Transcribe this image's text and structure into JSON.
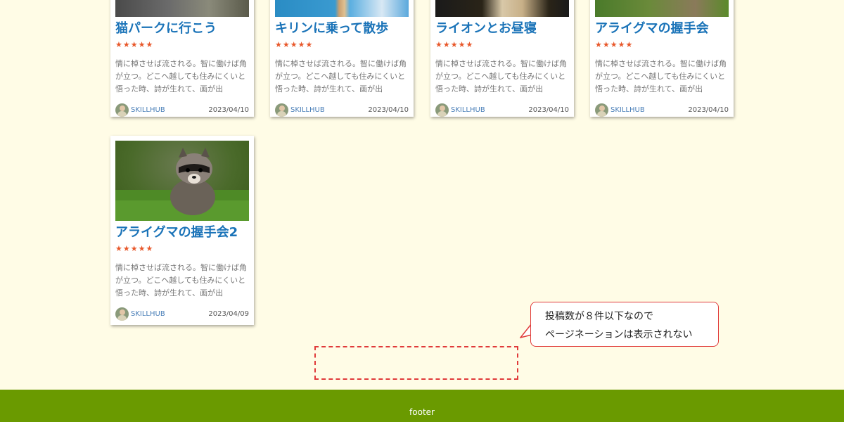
{
  "cards": [
    {
      "title": "猫パークに行こう",
      "stars": "★★★★★",
      "excerpt": "情に棹させば流される。智に働けば角が立つ。どこへ越しても住みにくいと悟った時、詩が生れて、画が出",
      "author": "SKILLHUB",
      "date": "2023/04/10",
      "image": "cat-photo"
    },
    {
      "title": "キリンに乗って散歩",
      "stars": "★★★★★",
      "excerpt": "情に棹させば流される。智に働けば角が立つ。どこへ越しても住みにくいと悟った時、詩が生れて、画が出",
      "author": "SKILLHUB",
      "date": "2023/04/10",
      "image": "giraffe-photo"
    },
    {
      "title": "ライオンとお昼寝",
      "stars": "★★★★★",
      "excerpt": "情に棹させば流される。智に働けば角が立つ。どこへ越しても住みにくいと悟った時、詩が生れて、画が出",
      "author": "SKILLHUB",
      "date": "2023/04/10",
      "image": "lion-photo"
    },
    {
      "title": "アライグマの握手会",
      "stars": "★★★★★",
      "excerpt": "情に棹させば流される。智に働けば角が立つ。どこへ越しても住みにくいと悟った時、詩が生れて、画が出",
      "author": "SKILLHUB",
      "date": "2023/04/10",
      "image": "raccoon-photo"
    },
    {
      "title": "アライグマの握手会2",
      "stars": "★★★★★",
      "excerpt": "情に棹させば流される。智に働けば角が立つ。どこへ越しても住みにくいと悟った時、詩が生れて、画が出",
      "author": "SKILLHUB",
      "date": "2023/04/09",
      "image": "raccoon-photo"
    }
  ],
  "annotation": {
    "line1": "投稿数が８件以下なので",
    "line2": "ページネーションは表示されない"
  },
  "footer": {
    "text": "footer"
  },
  "colors": {
    "background": "#fffce6",
    "title": "#1a73b8",
    "stars": "#e8572a",
    "footer": "#6a9a00",
    "annotation": "#e03a3a"
  }
}
